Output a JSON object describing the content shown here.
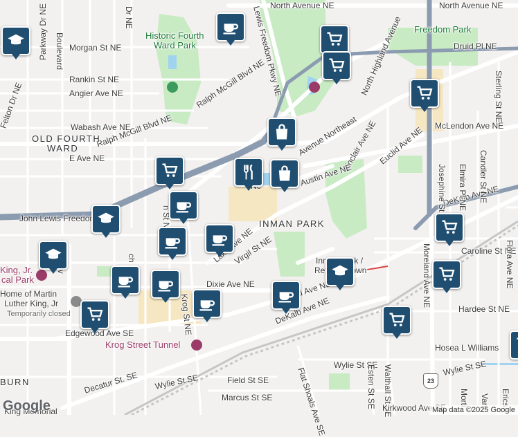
{
  "map": {
    "streets": {
      "north_avenue_ne_west": "North Avenue NE",
      "north_avenue_ne_east": "North Avenue NE",
      "boulevard_upper": "Boulevard",
      "parkway_dr_ne": "Parkway Dr NE",
      "dr_ne": "Dr NE",
      "morgan_st_ne": "Morgan St NE",
      "rankin_st_ne": "Rankin St NE",
      "angier_ave_ne": "Angier Ave NE",
      "ralph_mcgill_upper": "Ralph McGill Blvd NE",
      "ralph_mcgill_lower": "Ralph McGill Blvd NE",
      "felton_dr_ne": "Felton Dr NE",
      "wabash_ave_ne": "Wabash Ave NE",
      "e_ave_ne": "E Ave NE",
      "john_lewis_freedom": "John Lewis Freedom",
      "john_lewis_freedom_pkwy": "Lewis Freedom Pkwy NE",
      "north_highland_ave": "North Highland Avenue",
      "highland_avenue_northeast": "Avenue Northeast",
      "sinclair_ave_ne": "Sinclair Ave NE",
      "euclid_ave_ne": "Euclid Ave NE",
      "austin_ave_ne": "Austin Ave NE",
      "dekalb_ave_ne_upper": "DeKalb Ave NE",
      "mclendon_ave_ne": "McLendon Ave NE",
      "druid_pl_ne": "Druid Pl NE",
      "sterling_st_ne": "Sterling St NE",
      "josephine_st_ne": "Josephine St NE",
      "elmira_pl_ne": "Elmira Pl NE",
      "candler_st_ne": "Candler St NE",
      "caroline_st_ne": "Caroline St NE",
      "flora_ave_ne": "Flora Ave NE",
      "moreland_ave_ne": "Moreland Ave NE",
      "lake_ave_ne": "Lake Ave NE",
      "virgil_st_ne": "Virgil St NE",
      "dixie_ave_ne": "Dixie Ave NE",
      "krog_st_ne": "Krog St NE",
      "elwood_ave_ne": "d Ave NE",
      "dekalb_ave_ne_lower": "DeKalb Ave NE",
      "hardee_st_ne": "Hardee St NE",
      "hosea_williams": "Hosea L Williams",
      "edgewood_ave_se": "Edgewood Ave SE",
      "decatur_st_se": "Decatur St. SE",
      "wylie_st_se_left": "Wylie St SE",
      "wylie_st_se_mid": "Wylie St SE",
      "wylie_st_se_right": "Wylie St SE",
      "field_st_se": "Field St SE",
      "marcus_st_se": "Marcus St SE",
      "flat_shoals_ave": "Flat Shoals Ave SE",
      "esten_st_se": "Esten St SE",
      "walthall_st_se": "Walthall St SE",
      "kirkwood_ave_se": "Kirkwood Ave SE",
      "boulevard_lower": "Boulev",
      "ch_st_ne": "ch St NE",
      "n_st_ne": "n St NE",
      "nc_label": "Nc",
      "morti": "Morti",
      "vann": "Vann",
      "erics": "Erics"
    },
    "areas": {
      "old_fourth_ward_1": "OLD FOURTH",
      "old_fourth_ward_2": "WARD",
      "inman_park": "INMAN PARK",
      "auburn": "BURN"
    },
    "parks": {
      "historic_fourth_ward_1": "Historic Fourth",
      "historic_fourth_ward_2": "Ward Park",
      "freedom_park": "Freedom Park"
    },
    "places": {
      "mlk_1": "King, Jr.",
      "mlk_2": "cal Park",
      "home_mlk_1": "Home of Martin",
      "home_mlk_2": "Luther King, Jr",
      "temporarily_closed": "Temporarily closed",
      "krog_street_tunnel": "Krog Street Tunnel",
      "inman_park_station_1": "Inman Park /",
      "inman_park_station_2": "Reynoldstown",
      "king_memorial": "King Memorial"
    },
    "shields": {
      "us23": "23"
    },
    "markers": [
      {
        "icon": "graduation-cap-icon"
      },
      {
        "icon": "coffee-cup-icon"
      },
      {
        "icon": "shopping-cart-icon"
      },
      {
        "icon": "shopping-cart-icon"
      },
      {
        "icon": "shopping-cart-icon"
      },
      {
        "icon": "shopping-bag-icon"
      },
      {
        "icon": "restaurant-icon"
      },
      {
        "icon": "shopping-bag-icon"
      },
      {
        "icon": "shopping-cart-icon"
      },
      {
        "icon": "coffee-cup-icon"
      },
      {
        "icon": "graduation-cap-icon"
      },
      {
        "icon": "coffee-cup-icon"
      },
      {
        "icon": "coffee-cup-icon"
      },
      {
        "icon": "graduation-cap-icon"
      },
      {
        "icon": "coffee-cup-icon"
      },
      {
        "icon": "coffee-cup-icon"
      },
      {
        "icon": "coffee-cup-icon"
      },
      {
        "icon": "shopping-cart-icon"
      },
      {
        "icon": "coffee-cup-icon"
      },
      {
        "icon": "graduation-cap-icon"
      },
      {
        "icon": "shopping-cart-icon"
      },
      {
        "icon": "shopping-cart-icon"
      },
      {
        "icon": "shopping-cart-icon"
      },
      {
        "icon": "shopping-cart-icon"
      }
    ],
    "colors": {
      "marker": "#1f4e70",
      "park": "#c9ebc4",
      "highway": "#8b9bb0",
      "water": "#9fd3ef"
    }
  },
  "footer": {
    "logo": "Google",
    "attribution": "Map data ©2025 Google"
  }
}
